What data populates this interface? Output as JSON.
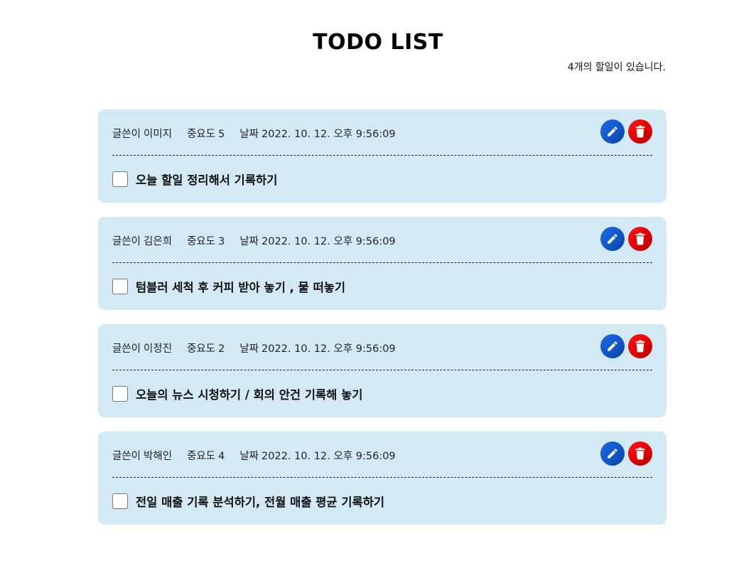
{
  "header": {
    "title": "TODO LIST",
    "count_text": "4개의 할일이 있습니다."
  },
  "labels": {
    "author": "글쓴이",
    "priority": "중요도",
    "date": "날짜"
  },
  "actions": {
    "edit_icon": "pencil-icon",
    "delete_icon": "trash-icon"
  },
  "colors": {
    "card_background": "#d3eaf5",
    "edit_button": "#0f57c9",
    "delete_button": "#e00000"
  },
  "todos": [
    {
      "author": "이미지",
      "priority": "5",
      "date": "2022. 10. 12. 오후 9:56:09",
      "text": "오늘 할일 정리해서 기록하기",
      "checked": false
    },
    {
      "author": "김은희",
      "priority": "3",
      "date": "2022. 10. 12. 오후 9:56:09",
      "text": "텀블러 세척 후 커피 받아 놓기 , 물 떠놓기",
      "checked": false
    },
    {
      "author": "이정진",
      "priority": "2",
      "date": "2022. 10. 12. 오후 9:56:09",
      "text": "오늘의 뉴스 시청하기 / 회의 안건 기록해 놓기",
      "checked": false
    },
    {
      "author": "박해인",
      "priority": "4",
      "date": "2022. 10. 12. 오후 9:56:09",
      "text": "전일 매출 기록 분석하기, 전월 매출 평균 기록하기",
      "checked": false
    }
  ]
}
